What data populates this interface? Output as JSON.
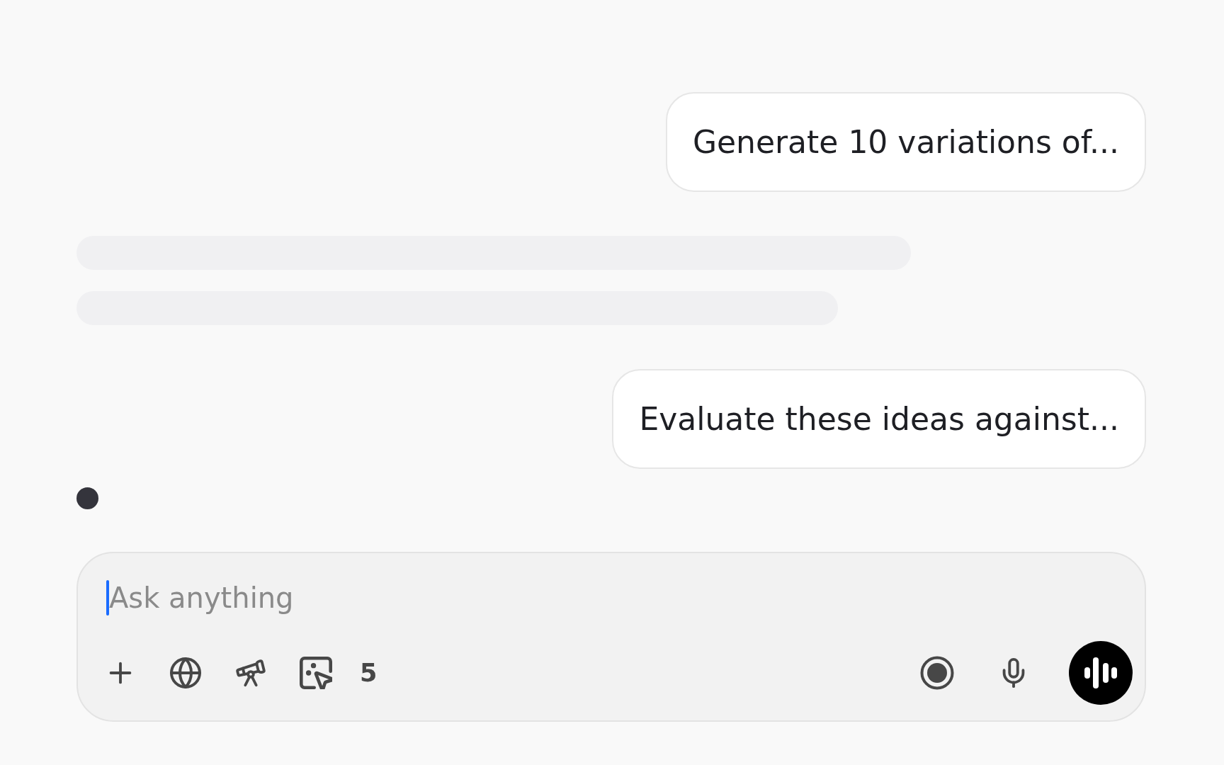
{
  "thread": [
    {
      "kind": "user",
      "text": "Generate 10 variations of..."
    },
    {
      "kind": "skeleton"
    },
    {
      "kind": "user",
      "text": "Evaluate these ideas against..."
    },
    {
      "kind": "typing"
    }
  ],
  "composer": {
    "placeholder": "Ask anything",
    "focused": true,
    "count": "5"
  }
}
